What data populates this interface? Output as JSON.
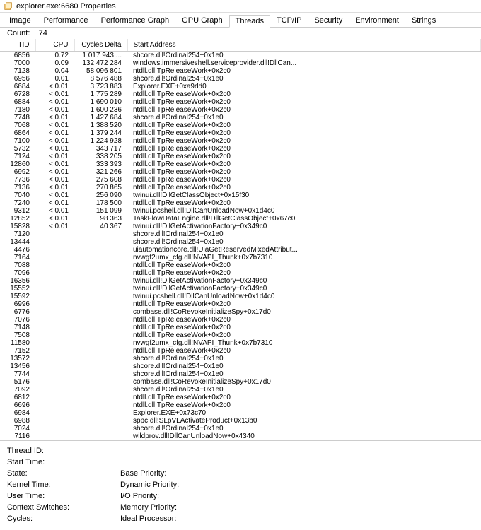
{
  "window": {
    "title": "explorer.exe:6680 Properties"
  },
  "tabs": [
    {
      "label": "Image"
    },
    {
      "label": "Performance"
    },
    {
      "label": "Performance Graph"
    },
    {
      "label": "GPU Graph"
    },
    {
      "label": "Threads"
    },
    {
      "label": "TCP/IP"
    },
    {
      "label": "Security"
    },
    {
      "label": "Environment"
    },
    {
      "label": "Strings"
    }
  ],
  "active_tab_index": 4,
  "count_label": "Count:",
  "count_value": "74",
  "columns": {
    "tid": "TID",
    "cpu": "CPU",
    "cycles": "Cycles Delta",
    "addr": "Start Address"
  },
  "threads": [
    {
      "tid": "6856",
      "cpu": "0.72",
      "cyc": "1 017 943 ...",
      "addr": "shcore.dll!Ordinal254+0x1e0"
    },
    {
      "tid": "7000",
      "cpu": "0.09",
      "cyc": "132 472 284",
      "addr": "windows.immersiveshell.serviceprovider.dll!DllCan..."
    },
    {
      "tid": "7128",
      "cpu": "0.04",
      "cyc": "58 096 801",
      "addr": "ntdll.dll!TpReleaseWork+0x2c0"
    },
    {
      "tid": "6956",
      "cpu": "0.01",
      "cyc": "8 576 488",
      "addr": "shcore.dll!Ordinal254+0x1e0"
    },
    {
      "tid": "6684",
      "cpu": "< 0.01",
      "cyc": "3 723 883",
      "addr": "Explorer.EXE+0xa9dd0"
    },
    {
      "tid": "6728",
      "cpu": "< 0.01",
      "cyc": "1 775 289",
      "addr": "ntdll.dll!TpReleaseWork+0x2c0"
    },
    {
      "tid": "6884",
      "cpu": "< 0.01",
      "cyc": "1 690 010",
      "addr": "ntdll.dll!TpReleaseWork+0x2c0"
    },
    {
      "tid": "7180",
      "cpu": "< 0.01",
      "cyc": "1 600 236",
      "addr": "ntdll.dll!TpReleaseWork+0x2c0"
    },
    {
      "tid": "7748",
      "cpu": "< 0.01",
      "cyc": "1 427 684",
      "addr": "shcore.dll!Ordinal254+0x1e0"
    },
    {
      "tid": "7068",
      "cpu": "< 0.01",
      "cyc": "1 388 520",
      "addr": "ntdll.dll!TpReleaseWork+0x2c0"
    },
    {
      "tid": "6864",
      "cpu": "< 0.01",
      "cyc": "1 379 244",
      "addr": "ntdll.dll!TpReleaseWork+0x2c0"
    },
    {
      "tid": "7100",
      "cpu": "< 0.01",
      "cyc": "1 224 928",
      "addr": "ntdll.dll!TpReleaseWork+0x2c0"
    },
    {
      "tid": "5732",
      "cpu": "< 0.01",
      "cyc": "343 717",
      "addr": "ntdll.dll!TpReleaseWork+0x2c0"
    },
    {
      "tid": "7124",
      "cpu": "< 0.01",
      "cyc": "338 205",
      "addr": "ntdll.dll!TpReleaseWork+0x2c0"
    },
    {
      "tid": "12860",
      "cpu": "< 0.01",
      "cyc": "333 393",
      "addr": "ntdll.dll!TpReleaseWork+0x2c0"
    },
    {
      "tid": "6992",
      "cpu": "< 0.01",
      "cyc": "321 266",
      "addr": "ntdll.dll!TpReleaseWork+0x2c0"
    },
    {
      "tid": "7736",
      "cpu": "< 0.01",
      "cyc": "275 608",
      "addr": "ntdll.dll!TpReleaseWork+0x2c0"
    },
    {
      "tid": "7136",
      "cpu": "< 0.01",
      "cyc": "270 865",
      "addr": "ntdll.dll!TpReleaseWork+0x2c0"
    },
    {
      "tid": "7040",
      "cpu": "< 0.01",
      "cyc": "256 090",
      "addr": "twinui.dll!DllGetClassObject+0x15f30"
    },
    {
      "tid": "7240",
      "cpu": "< 0.01",
      "cyc": "178 500",
      "addr": "ntdll.dll!TpReleaseWork+0x2c0"
    },
    {
      "tid": "9312",
      "cpu": "< 0.01",
      "cyc": "151 099",
      "addr": "twinui.pcshell.dll!DllCanUnloadNow+0x1d4c0"
    },
    {
      "tid": "12852",
      "cpu": "< 0.01",
      "cyc": "98 363",
      "addr": "TaskFlowDataEngine.dll!DllGetClassObject+0x67c0"
    },
    {
      "tid": "15828",
      "cpu": "< 0.01",
      "cyc": "40 367",
      "addr": "twinui.dll!DllGetActivationFactory+0x349c0"
    },
    {
      "tid": "7120",
      "cpu": "",
      "cyc": "",
      "addr": "shcore.dll!Ordinal254+0x1e0"
    },
    {
      "tid": "13444",
      "cpu": "",
      "cyc": "",
      "addr": "shcore.dll!Ordinal254+0x1e0"
    },
    {
      "tid": "4476",
      "cpu": "",
      "cyc": "",
      "addr": "uiautomationcore.dll!UiaGetReservedMixedAttribut..."
    },
    {
      "tid": "7164",
      "cpu": "",
      "cyc": "",
      "addr": "nvwgf2umx_cfg.dll!NVAPI_Thunk+0x7b7310"
    },
    {
      "tid": "7088",
      "cpu": "",
      "cyc": "",
      "addr": "ntdll.dll!TpReleaseWork+0x2c0"
    },
    {
      "tid": "7096",
      "cpu": "",
      "cyc": "",
      "addr": "ntdll.dll!TpReleaseWork+0x2c0"
    },
    {
      "tid": "16356",
      "cpu": "",
      "cyc": "",
      "addr": "twinui.dll!DllGetActivationFactory+0x349c0"
    },
    {
      "tid": "15552",
      "cpu": "",
      "cyc": "",
      "addr": "twinui.dll!DllGetActivationFactory+0x349c0"
    },
    {
      "tid": "15592",
      "cpu": "",
      "cyc": "",
      "addr": "twinui.pcshell.dll!DllCanUnloadNow+0x1d4c0"
    },
    {
      "tid": "6996",
      "cpu": "",
      "cyc": "",
      "addr": "ntdll.dll!TpReleaseWork+0x2c0"
    },
    {
      "tid": "6776",
      "cpu": "",
      "cyc": "",
      "addr": "combase.dll!CoRevokeInitializeSpy+0x17d0"
    },
    {
      "tid": "7076",
      "cpu": "",
      "cyc": "",
      "addr": "ntdll.dll!TpReleaseWork+0x2c0"
    },
    {
      "tid": "7148",
      "cpu": "",
      "cyc": "",
      "addr": "ntdll.dll!TpReleaseWork+0x2c0"
    },
    {
      "tid": "7508",
      "cpu": "",
      "cyc": "",
      "addr": "ntdll.dll!TpReleaseWork+0x2c0"
    },
    {
      "tid": "11580",
      "cpu": "",
      "cyc": "",
      "addr": "nvwgf2umx_cfg.dll!NVAPI_Thunk+0x7b7310"
    },
    {
      "tid": "7152",
      "cpu": "",
      "cyc": "",
      "addr": "ntdll.dll!TpReleaseWork+0x2c0"
    },
    {
      "tid": "13572",
      "cpu": "",
      "cyc": "",
      "addr": "shcore.dll!Ordinal254+0x1e0"
    },
    {
      "tid": "13456",
      "cpu": "",
      "cyc": "",
      "addr": "shcore.dll!Ordinal254+0x1e0"
    },
    {
      "tid": "7744",
      "cpu": "",
      "cyc": "",
      "addr": "shcore.dll!Ordinal254+0x1e0"
    },
    {
      "tid": "5176",
      "cpu": "",
      "cyc": "",
      "addr": "combase.dll!CoRevokeInitializeSpy+0x17d0"
    },
    {
      "tid": "7092",
      "cpu": "",
      "cyc": "",
      "addr": "shcore.dll!Ordinal254+0x1e0"
    },
    {
      "tid": "6812",
      "cpu": "",
      "cyc": "",
      "addr": "ntdll.dll!TpReleaseWork+0x2c0"
    },
    {
      "tid": "6696",
      "cpu": "",
      "cyc": "",
      "addr": "ntdll.dll!TpReleaseWork+0x2c0"
    },
    {
      "tid": "6984",
      "cpu": "",
      "cyc": "",
      "addr": "Explorer.EXE+0x73c70"
    },
    {
      "tid": "6988",
      "cpu": "",
      "cyc": "",
      "addr": "sppc.dll!SLpVLActivateProduct+0x13b0"
    },
    {
      "tid": "7024",
      "cpu": "",
      "cyc": "",
      "addr": "shcore.dll!Ordinal254+0x1e0"
    },
    {
      "tid": "7116",
      "cpu": "",
      "cyc": "",
      "addr": "wildprov.dll!DllCanUnloadNow+0x4340"
    }
  ],
  "details": {
    "left": [
      "Thread ID:",
      "Start Time:",
      "State:",
      "Kernel Time:",
      "User Time:",
      "Context Switches:",
      "Cycles:"
    ],
    "right": [
      "Base Priority:",
      "Dynamic Priority:",
      "I/O Priority:",
      "Memory Priority:",
      "Ideal Processor:"
    ]
  }
}
